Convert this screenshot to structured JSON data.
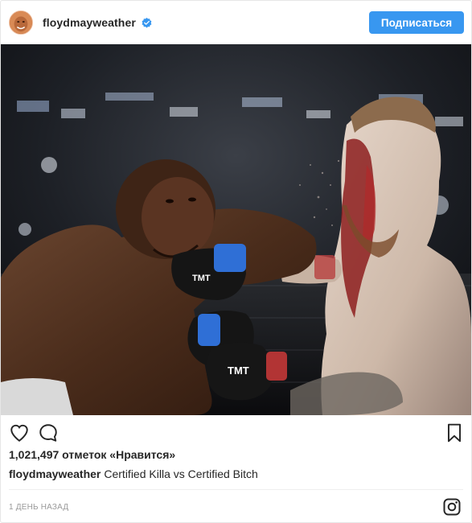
{
  "header": {
    "username": "floydmayweather",
    "follow_label": "Подписаться",
    "verified_icon": "verified-badge-icon",
    "accent_color": "#3897f0"
  },
  "photo": {
    "glove_text_1": "TMT",
    "glove_text_2": "TMT"
  },
  "actions": {
    "like_icon": "heart-icon",
    "comment_icon": "comment-icon",
    "save_icon": "bookmark-icon"
  },
  "likes": {
    "text": "1,021,497 отметок «Нравится»"
  },
  "caption": {
    "username": "floydmayweather",
    "text": "Certified Killa vs Certified Bitch"
  },
  "footer": {
    "timestamp": "1 ДЕНЬ НАЗАД",
    "logo_icon": "instagram-logo-icon"
  }
}
